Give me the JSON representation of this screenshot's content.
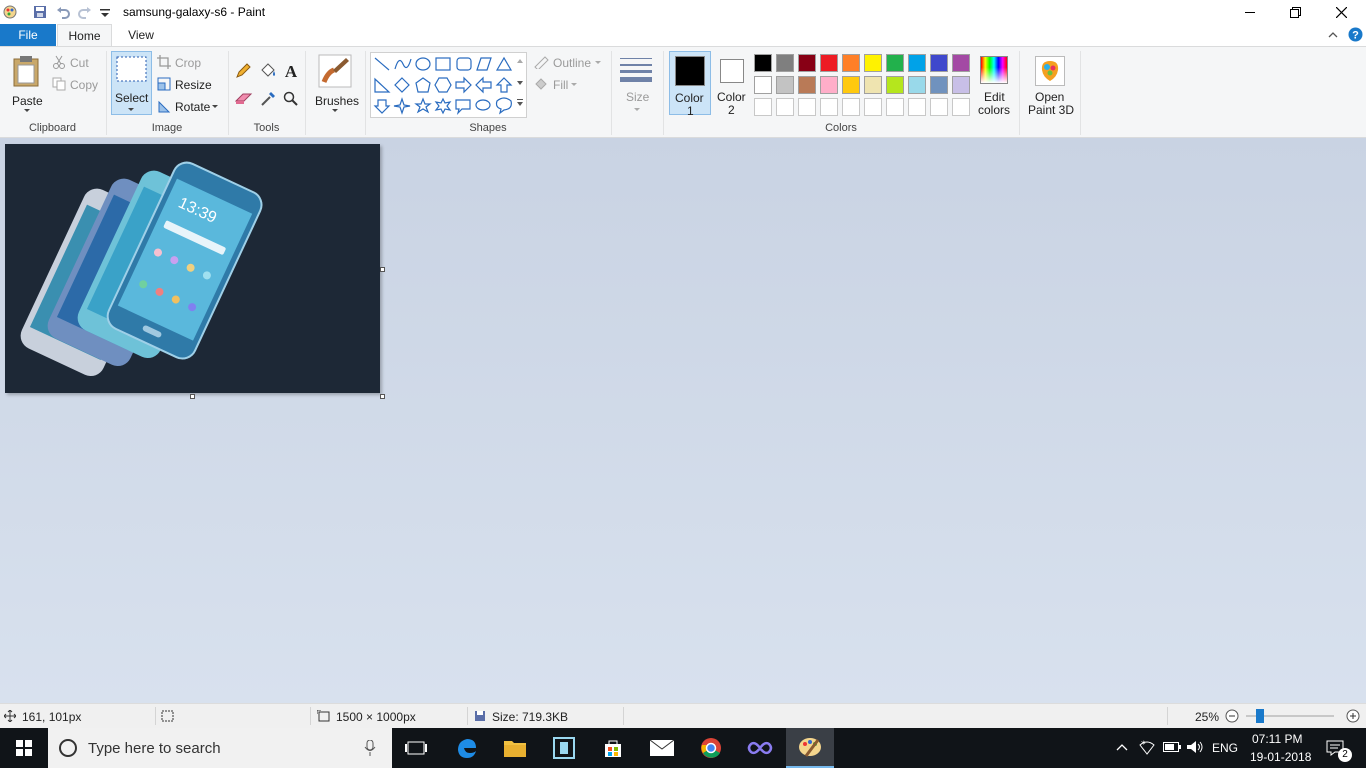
{
  "window": {
    "title": "samsung-galaxy-s6 - Paint",
    "min_icon": "minimize-icon",
    "max_icon": "restore-icon",
    "close_icon": "close-icon"
  },
  "tabs": {
    "file": "File",
    "home": "Home",
    "view": "View"
  },
  "ribbon": {
    "clipboard": {
      "label": "Clipboard",
      "paste": "Paste",
      "cut": "Cut",
      "copy": "Copy"
    },
    "image": {
      "label": "Image",
      "select": "Select",
      "crop": "Crop",
      "resize": "Resize",
      "rotate": "Rotate"
    },
    "tools": {
      "label": "Tools"
    },
    "brushes": {
      "label": "Brushes"
    },
    "shapes": {
      "label": "Shapes",
      "outline": "Outline",
      "fill": "Fill"
    },
    "size": {
      "label": "Size"
    },
    "colors": {
      "label": "Colors",
      "color1": [
        "Color",
        "1"
      ],
      "color2": [
        "Color",
        "2"
      ],
      "edit": [
        "Edit",
        "colors"
      ],
      "color1_value": "#000000",
      "color2_value": "#ffffff",
      "palette_row1": [
        "#000000",
        "#7f7f7f",
        "#880015",
        "#ed1c24",
        "#ff7f27",
        "#fff200",
        "#22b14c",
        "#00a2e8",
        "#3f48cc",
        "#a349a4"
      ],
      "palette_row2": [
        "#ffffff",
        "#c3c3c3",
        "#b97a57",
        "#ffaec9",
        "#ffc90e",
        "#efe4b0",
        "#b5e61d",
        "#99d9ea",
        "#7092be",
        "#c8bfe7"
      ],
      "palette_row3": [
        "#ffffff",
        "#ffffff",
        "#ffffff",
        "#ffffff",
        "#ffffff",
        "#ffffff",
        "#ffffff",
        "#ffffff",
        "#ffffff",
        "#ffffff"
      ]
    },
    "paint3d": [
      "Open",
      "Paint 3D"
    ]
  },
  "status": {
    "cursor_pos": "161, 101px",
    "dimensions": "1500 × 1000px",
    "size": "Size: 719.3KB",
    "zoom": "25%",
    "zoom_level_fraction": 0.0
  },
  "taskbar": {
    "search_placeholder": "Type here to search",
    "language": "ENG",
    "time": "07:11 PM",
    "date": "19-01-2018",
    "notifications": "2"
  }
}
